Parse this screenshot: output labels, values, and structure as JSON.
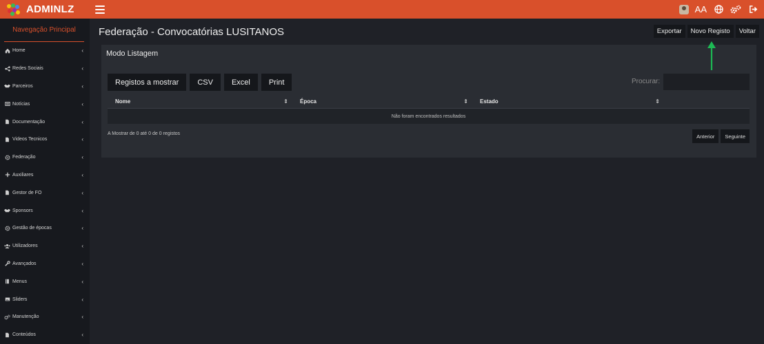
{
  "brand": {
    "name": "ADMINLZ"
  },
  "header": {
    "font_size_label": "AA",
    "accent_color": "#d9502b"
  },
  "sidebar": {
    "heading": "Navegação Principal",
    "items": [
      {
        "label": "Home",
        "icon": "home-icon"
      },
      {
        "label": "Redes Sociais",
        "icon": "share-icon"
      },
      {
        "label": "Parceiros",
        "icon": "handshake-icon"
      },
      {
        "label": "Notícias",
        "icon": "newspaper-icon"
      },
      {
        "label": "Documentação",
        "icon": "file-icon"
      },
      {
        "label": "Videos Tecnicos",
        "icon": "file-icon"
      },
      {
        "label": "Federação",
        "icon": "gear-icon"
      },
      {
        "label": "Auxiliares",
        "icon": "plus-icon"
      },
      {
        "label": "Gestor de FO",
        "icon": "file-icon"
      },
      {
        "label": "Sponsors",
        "icon": "handshake-icon"
      },
      {
        "label": "Gestão de épocas",
        "icon": "gear-icon"
      },
      {
        "label": "Utilizadores",
        "icon": "users-icon"
      },
      {
        "label": "Avançados",
        "icon": "wrench-icon"
      },
      {
        "label": "Menus",
        "icon": "book-icon"
      },
      {
        "label": "Sliders",
        "icon": "images-icon"
      },
      {
        "label": "Manutenção",
        "icon": "gears-icon"
      },
      {
        "label": "Conteúdos",
        "icon": "file-icon"
      }
    ]
  },
  "main": {
    "title": "Federação - Convocatórias LUSITANOS",
    "actions": {
      "export": "Exportar",
      "new": "Novo Registo",
      "back": "Voltar"
    },
    "panel": {
      "title": "Modo Listagem",
      "tools": {
        "show": "Registos a mostrar",
        "csv": "CSV",
        "excel": "Excel",
        "print": "Print"
      },
      "search_label": "Procurar:",
      "search_value": "",
      "columns": [
        "Nome",
        "Época",
        "Estado"
      ],
      "empty_message": "Não foram encontrados resultados",
      "info": "A Mostrar de 0 até 0 de 0 registos",
      "pager": {
        "prev": "Anterior",
        "next": "Seguinte"
      }
    }
  },
  "annotation": {
    "arrow_color": "#1db954"
  }
}
